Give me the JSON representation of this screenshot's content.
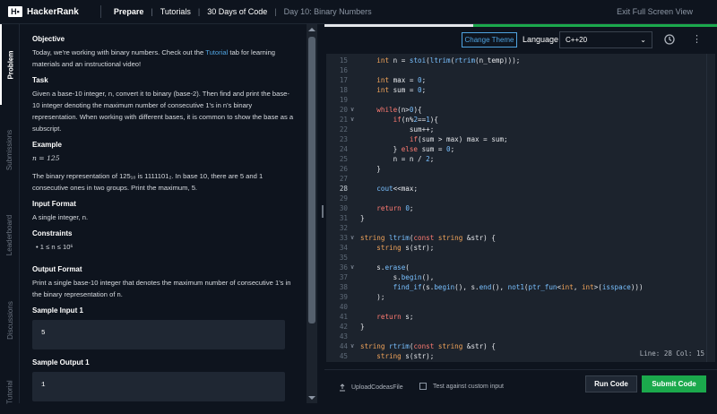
{
  "header": {
    "logo": "HackerRank",
    "breadcrumbs": [
      "Prepare",
      "Tutorials",
      "30 Days of Code",
      "Day 10: Binary Numbers"
    ],
    "exit_label": "Exit Full Screen View"
  },
  "side_tabs": [
    {
      "label": "Problem",
      "active": true
    },
    {
      "label": "Submissions",
      "active": false
    },
    {
      "label": "Leaderboard",
      "active": false
    },
    {
      "label": "Discussions",
      "active": false
    },
    {
      "label": "Tutorial",
      "active": false
    }
  ],
  "problem": {
    "objective_title": "Objective",
    "objective_text_1": "Today, we're working with binary numbers. Check out the ",
    "objective_link": "Tutorial",
    "objective_text_2": " tab for learning materials and an instructional video!",
    "task_title": "Task",
    "task_text": "Given a base-10 integer, n, convert it to binary (base-2). Then find and print the base-10 integer denoting the maximum number of consecutive 1's in n's binary representation. When working with different bases, it is common to show the base as a subscript.",
    "example_title": "Example",
    "example_math": "n = 125",
    "example_text": "The binary representation of 125₁₀ is 1111101₂. In base 10, there are 5 and 1 consecutive ones in two groups. Print the maximum, 5.",
    "input_title": "Input Format",
    "input_text": "A single integer, n.",
    "constraints_title": "Constraints",
    "constraint": "• 1 ≤ n ≤ 10⁶",
    "output_title": "Output Format",
    "output_text": "Print a single base-10 integer that denotes the maximum number of consecutive 1's in the binary representation of n.",
    "sample_input_title": "Sample Input 1",
    "sample_input_value": "5",
    "sample_output_title": "Sample Output 1",
    "sample_output_value": "1"
  },
  "editor": {
    "change_theme": "Change Theme",
    "language_label": "Language",
    "language_value": "C++20",
    "status": "Line: 28 Col: 15",
    "progress": 0.62,
    "lines": [
      {
        "n": "15",
        "fold": "",
        "code": "    int n = stoi(ltrim(rtrim(n_temp)));"
      },
      {
        "n": "16",
        "fold": "",
        "code": ""
      },
      {
        "n": "17",
        "fold": "",
        "code": "    int max = 0;"
      },
      {
        "n": "18",
        "fold": "",
        "code": "    int sum = 0;"
      },
      {
        "n": "19",
        "fold": "",
        "code": ""
      },
      {
        "n": "20",
        "fold": "∨",
        "code": "    while(n>0){"
      },
      {
        "n": "21",
        "fold": "∨",
        "code": "        if(n%2==1){"
      },
      {
        "n": "22",
        "fold": "",
        "code": "            sum++;"
      },
      {
        "n": "23",
        "fold": "",
        "code": "            if(sum > max) max = sum;"
      },
      {
        "n": "24",
        "fold": "",
        "code": "        } else sum = 0;"
      },
      {
        "n": "25",
        "fold": "",
        "code": "        n = n / 2;"
      },
      {
        "n": "26",
        "fold": "",
        "code": "    }"
      },
      {
        "n": "27",
        "fold": "",
        "code": ""
      },
      {
        "n": "28",
        "fold": "",
        "code": "    cout<<max;"
      },
      {
        "n": "29",
        "fold": "",
        "code": ""
      },
      {
        "n": "30",
        "fold": "",
        "code": "    return 0;"
      },
      {
        "n": "31",
        "fold": "",
        "code": "}"
      },
      {
        "n": "32",
        "fold": "",
        "code": ""
      },
      {
        "n": "33",
        "fold": "∨",
        "code": "string ltrim(const string &str) {"
      },
      {
        "n": "34",
        "fold": "",
        "code": "    string s(str);"
      },
      {
        "n": "35",
        "fold": "",
        "code": ""
      },
      {
        "n": "36",
        "fold": "∨",
        "code": "    s.erase("
      },
      {
        "n": "37",
        "fold": "",
        "code": "        s.begin(),"
      },
      {
        "n": "38",
        "fold": "",
        "code": "        find_if(s.begin(), s.end(), not1(ptr_fun<int, int>(isspace)))"
      },
      {
        "n": "39",
        "fold": "",
        "code": "    );"
      },
      {
        "n": "40",
        "fold": "",
        "code": ""
      },
      {
        "n": "41",
        "fold": "",
        "code": "    return s;"
      },
      {
        "n": "42",
        "fold": "",
        "code": "}"
      },
      {
        "n": "43",
        "fold": "",
        "code": ""
      },
      {
        "n": "44",
        "fold": "∨",
        "code": "string rtrim(const string &str) {"
      },
      {
        "n": "45",
        "fold": "",
        "code": "    string s(str);"
      }
    ]
  },
  "footer": {
    "upload_label": "UploadCodeasFile",
    "custom_input_label": "Test against custom input",
    "run_label": "Run Code",
    "submit_label": "Submit Code"
  },
  "colors": {
    "accent": "#1ba94c",
    "link": "#4fa3e0",
    "background": "#0e141e",
    "editor_bg": "#1c232d"
  }
}
